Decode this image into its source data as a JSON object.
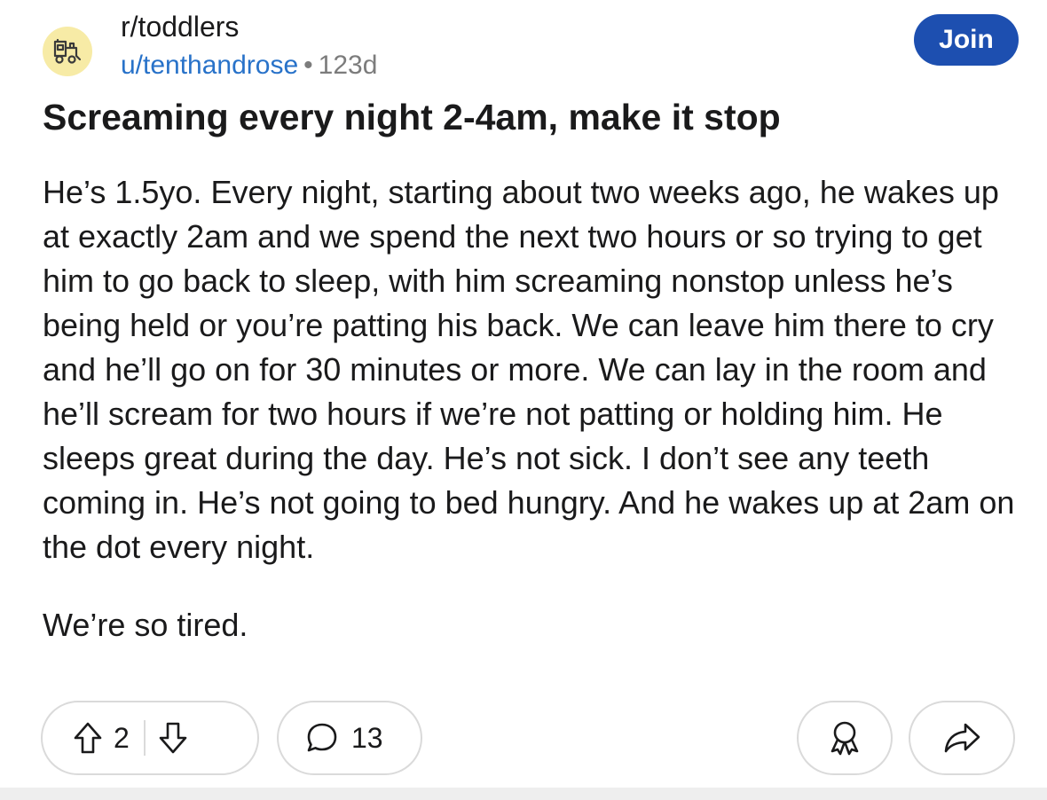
{
  "post": {
    "subreddit": "r/toddlers",
    "username": "u/tenthandrose",
    "separator": "•",
    "age": "123d",
    "join_label": "Join",
    "title": "Screaming every night 2-4am, make it stop",
    "body": [
      "He’s 1.5yo. Every night, starting about two weeks ago, he wakes up at exactly 2am and we spend the next two hours or so trying to get him to go back to sleep, with him screaming nonstop unless he’s being held or you’re patting his back. We can leave him there to cry and he’ll go on for 30 minutes or more. We can lay in the room and he’ll scream for two hours if we’re not patting or holding him. He sleeps great during the day. He’s not sick. I don’t see any teeth coming in. He’s not going to bed hungry. And he wakes up at 2am on the dot every night.",
      "We’re so tired."
    ]
  },
  "actions": {
    "vote_count": "2",
    "comment_count": "13"
  },
  "icons": {
    "avatar": "train-icon",
    "upvote": "upvote-arrow-icon",
    "downvote": "downvote-arrow-icon",
    "comment": "comment-bubble-icon",
    "award": "award-icon",
    "share": "share-arrow-icon"
  },
  "colors": {
    "join_button": "#1d4fb0",
    "username": "#2872c9",
    "avatar_bg": "#f7eba6"
  }
}
